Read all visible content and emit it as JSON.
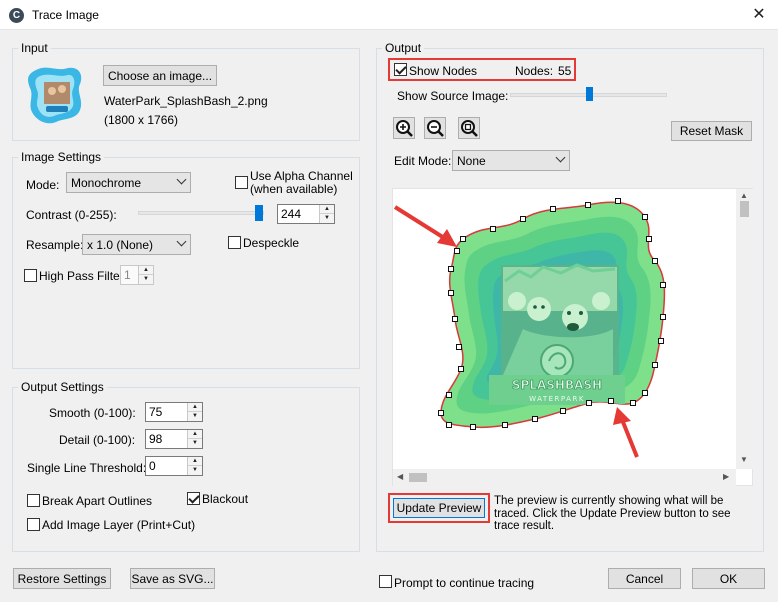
{
  "window": {
    "title": "Trace Image",
    "close": "✕",
    "app_icon_letter": "C"
  },
  "input": {
    "group_label": "Input",
    "choose_button": "Choose an image...",
    "filename": "WaterPark_SplashBash_2.png",
    "dimensions": "(1800 x 1766)"
  },
  "image_settings": {
    "group_label": "Image Settings",
    "mode_label": "Mode:",
    "mode_value": "Monochrome",
    "alpha_label_line1": "Use Alpha Channel",
    "alpha_label_line2": "(when available)",
    "contrast_label": "Contrast (0-255):",
    "contrast_value": "244",
    "contrast_fraction": 0.957,
    "resample_label": "Resample:",
    "resample_value": "x 1.0 (None)",
    "despeckle_label": "Despeckle",
    "highpass_label": "High Pass Filter",
    "highpass_value": "1"
  },
  "output_settings": {
    "group_label": "Output Settings",
    "smooth_label": "Smooth (0-100):",
    "smooth_value": "75",
    "detail_label": "Detail (0-100):",
    "detail_value": "98",
    "threshold_label": "Single Line Threshold:",
    "threshold_value": "0",
    "break_apart_label": "Break Apart Outlines",
    "blackout_label": "Blackout",
    "add_layer_label": "Add Image Layer (Print+Cut)"
  },
  "output": {
    "group_label": "Output",
    "show_nodes_label": "Show Nodes",
    "nodes_label": "Nodes:",
    "nodes_value": "55",
    "show_source_label": "Show Source Image:",
    "source_fraction": 0.5,
    "reset_mask": "Reset Mask",
    "edit_mode_label": "Edit Mode:",
    "edit_mode_value": "None",
    "logo_line1": "SPLASHBASH",
    "logo_line2": "WATERPARK",
    "update_preview": "Update Preview",
    "preview_note": "The preview is currently showing what will be traced. Click the Update Preview button to see trace result."
  },
  "footer": {
    "restore": "Restore Settings",
    "save_svg": "Save as SVG...",
    "prompt_label": "Prompt to continue tracing",
    "cancel": "Cancel",
    "ok": "OK"
  },
  "colors": {
    "accent": "#0078d7",
    "highlight": "#e53935",
    "trace_fill": "#7ee08a",
    "trace_outline": "#d63a3a"
  }
}
